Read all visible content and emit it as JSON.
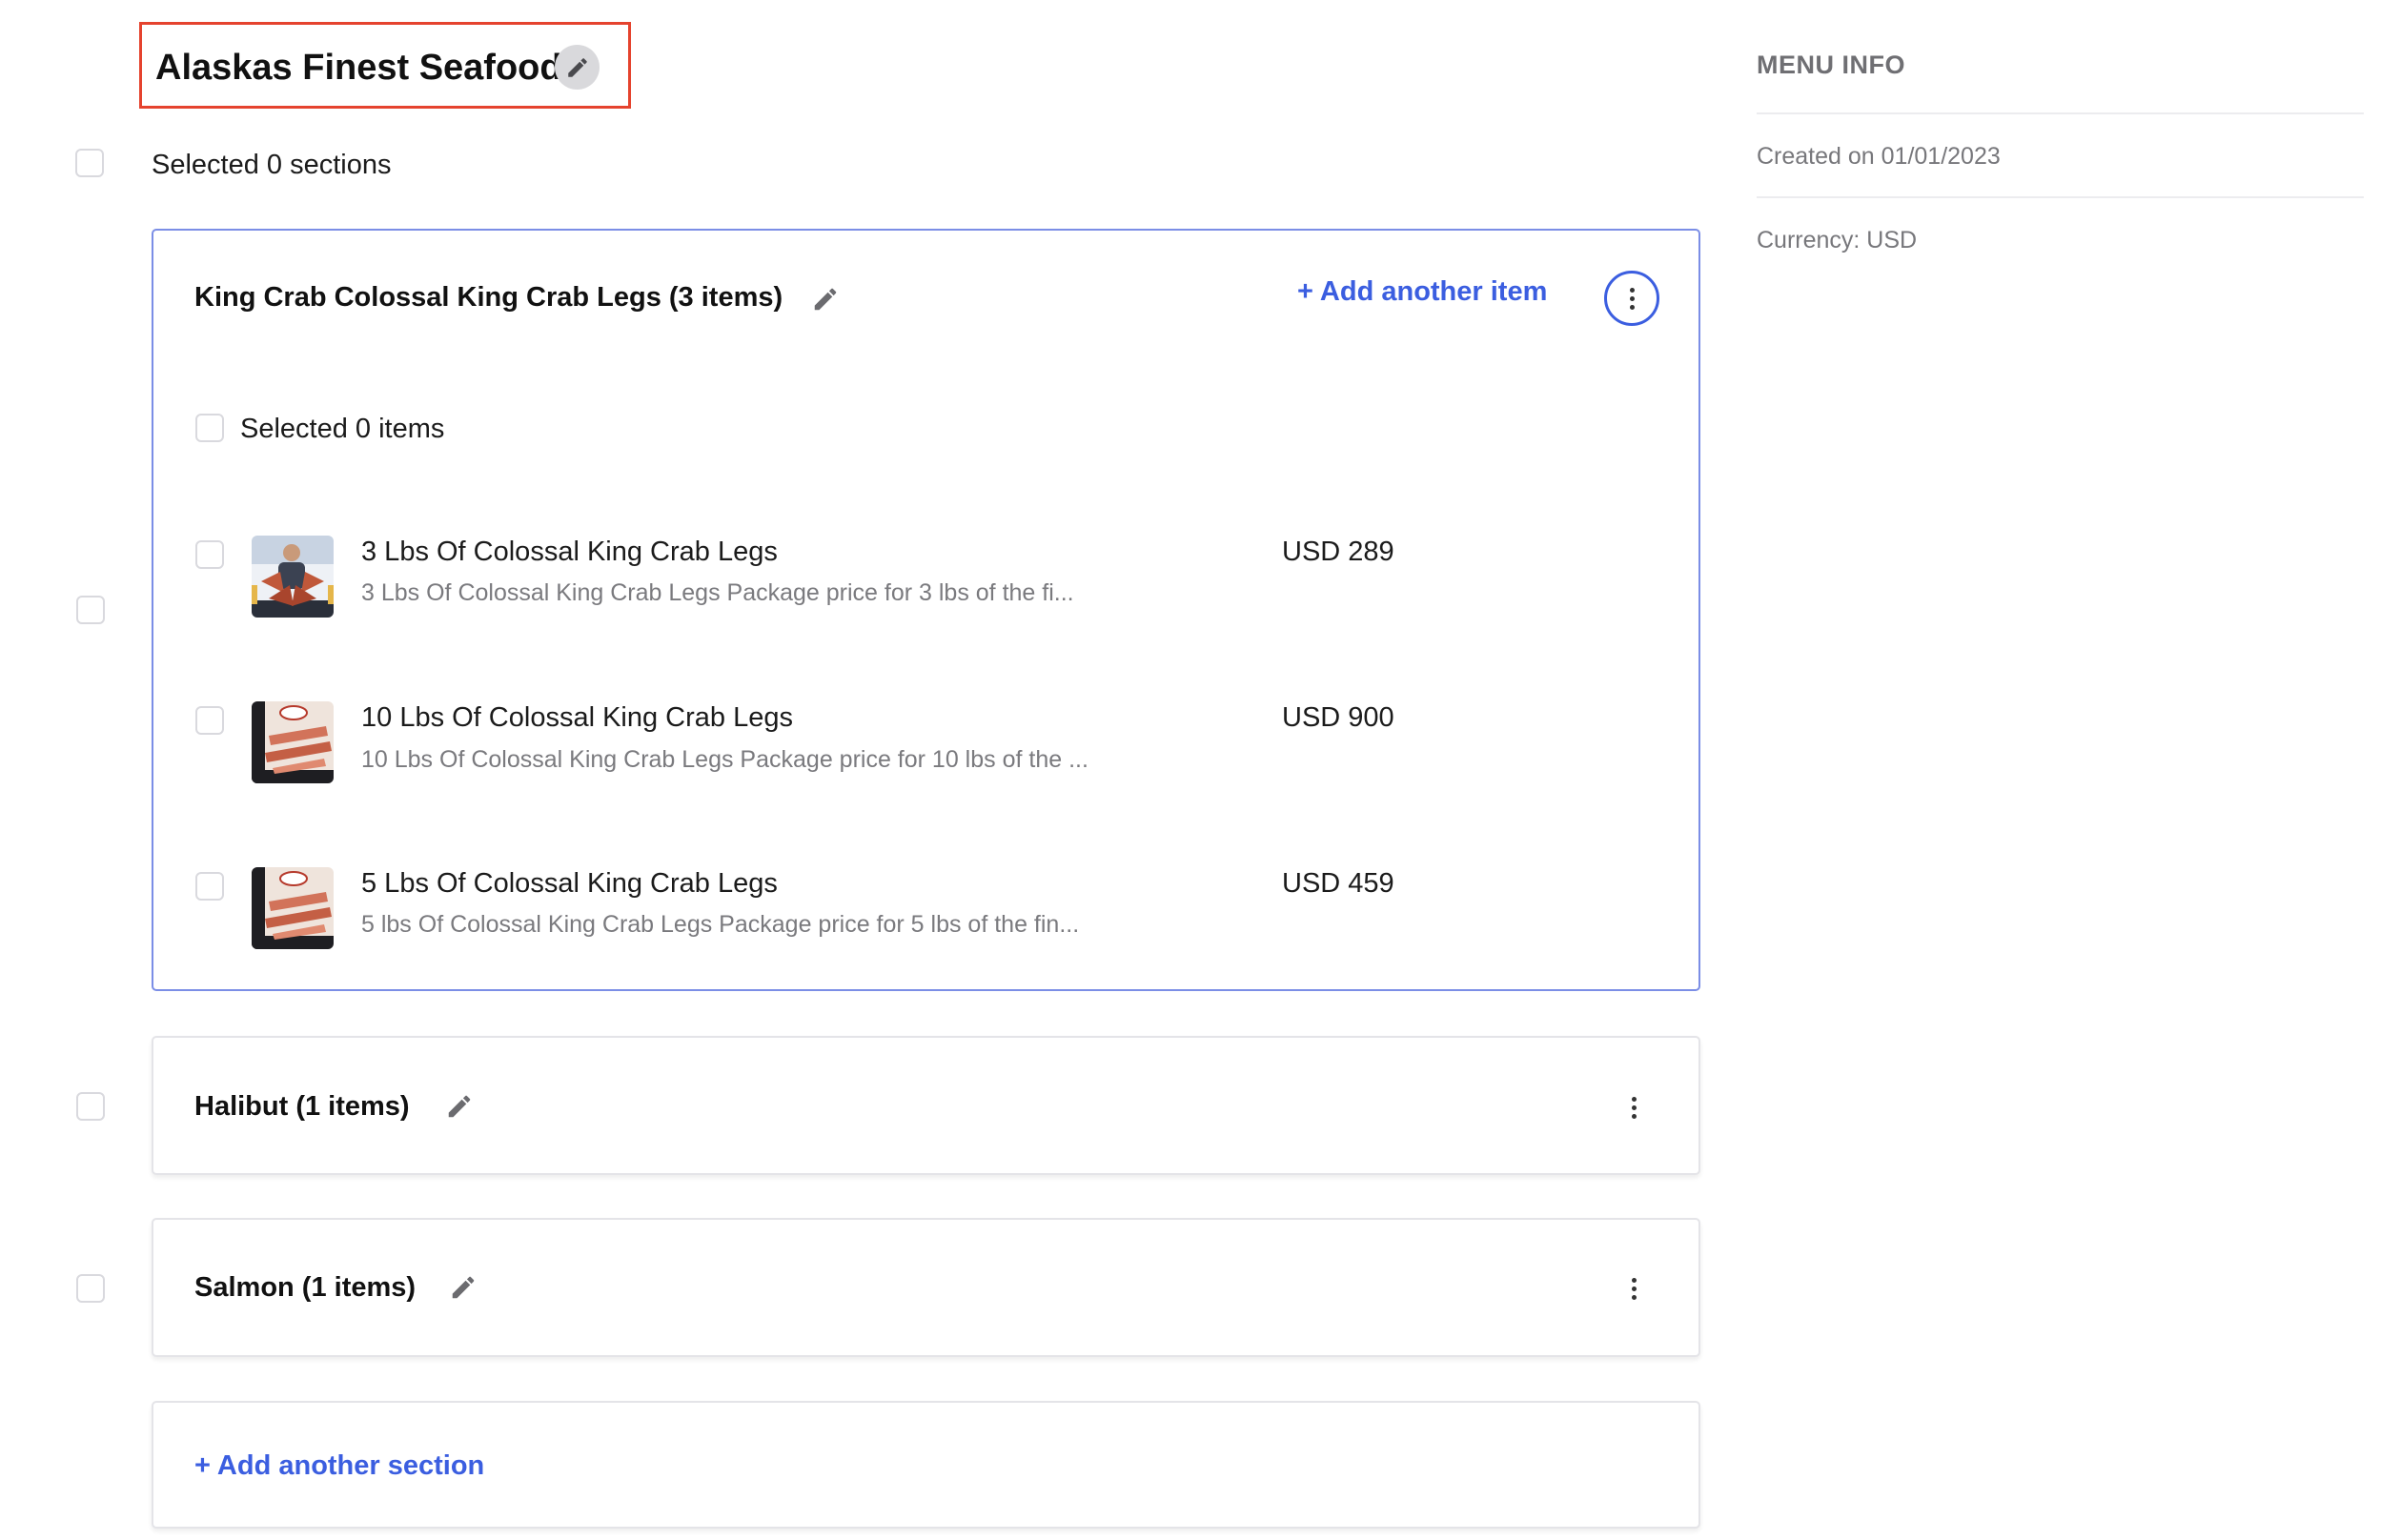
{
  "menu": {
    "title": "Alaskas Finest Seafood",
    "selected_sections_text": "Selected 0 sections"
  },
  "sections": [
    {
      "title": "King Crab Colossal King Crab Legs (3 items)",
      "expanded": true,
      "add_item_label": "+ Add another item",
      "selected_items_text": "Selected 0 items",
      "items": [
        {
          "name": "3 Lbs Of Colossal King Crab Legs",
          "description": "3 Lbs Of Colossal King Crab Legs Package price for 3 lbs of the fi...",
          "price": "USD 289",
          "thumbnail_icon": "king-crab-person-photo"
        },
        {
          "name": "10 Lbs Of Colossal King Crab Legs",
          "description": "10 Lbs Of Colossal King Crab Legs Package price for 10 lbs of the ...",
          "price": "USD 900",
          "thumbnail_icon": "king-crab-legs-photo"
        },
        {
          "name": "5 Lbs Of Colossal King Crab Legs",
          "description": "5 lbs Of Colossal King Crab Legs Package price for 5 lbs of the fin...",
          "price": "USD 459",
          "thumbnail_icon": "king-crab-legs-photo"
        }
      ]
    },
    {
      "title": "Halibut (1 items)",
      "expanded": false
    },
    {
      "title": "Salmon (1 items)",
      "expanded": false
    }
  ],
  "add_section_label": "+ Add another section",
  "menu_info": {
    "heading": "MENU INFO",
    "created": "Created on 01/01/2023",
    "currency": "Currency: USD"
  },
  "colors": {
    "accent": "#3b5ee0",
    "highlight_border": "#e5432e",
    "expanded_card_border": "#7b8ee6"
  },
  "icons": {
    "edit": "pencil-icon",
    "more": "kebab-menu-icon"
  }
}
